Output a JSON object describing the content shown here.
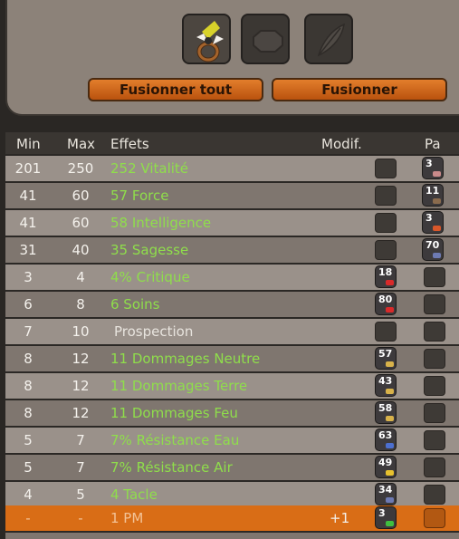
{
  "buttons": {
    "merge_all": "Fusionner tout",
    "merge": "Fusionner"
  },
  "header": {
    "min": "Min",
    "max": "Max",
    "effects": "Effets",
    "modif": "Modif.",
    "pa": "Pa"
  },
  "rows": [
    {
      "min": "201",
      "max": "250",
      "effect": "252 Vitalité",
      "pa_rune": "3",
      "pa_color": "#c98a8a"
    },
    {
      "min": "41",
      "max": "60",
      "effect": "57 Force",
      "pa_rune": "11",
      "pa_color": "#8a6b4d"
    },
    {
      "min": "41",
      "max": "60",
      "effect": "58 Intelligence",
      "pa_rune": "3",
      "pa_color": "#d9572a"
    },
    {
      "min": "31",
      "max": "40",
      "effect": "35 Sagesse",
      "pa_rune": "70",
      "pa_color": "#6d7ab3"
    },
    {
      "min": "3",
      "max": "4",
      "effect": "4% Critique",
      "mod_rune": "18",
      "mod_color": "#d92a2a"
    },
    {
      "min": "6",
      "max": "8",
      "effect": "6 Soins",
      "mod_rune": "80",
      "mod_color": "#d92a2a"
    },
    {
      "min": "7",
      "max": "10",
      "effect": "Prospection"
    },
    {
      "min": "8",
      "max": "12",
      "effect": "11 Dommages Neutre",
      "mod_rune": "57",
      "mod_color": "#d8b24a"
    },
    {
      "min": "8",
      "max": "12",
      "effect": "11 Dommages Terre",
      "mod_rune": "43",
      "mod_color": "#d8b24a"
    },
    {
      "min": "8",
      "max": "12",
      "effect": "11 Dommages Feu",
      "mod_rune": "58",
      "mod_color": "#d8b24a"
    },
    {
      "min": "5",
      "max": "7",
      "effect": "7% Résistance Eau",
      "mod_rune": "63",
      "mod_color": "#4c6fcf"
    },
    {
      "min": "5",
      "max": "7",
      "effect": "7% Résistance Air",
      "mod_rune": "49",
      "mod_color": "#e7c12e"
    },
    {
      "min": "4",
      "max": "5",
      "effect": "4 Tacle",
      "mod_rune": "34",
      "mod_color": "#6d7ab3"
    },
    {
      "min": "-",
      "max": "-",
      "effect": "1 PM",
      "modif": "+1",
      "mod_rune": "3",
      "mod_color": "#3fbf3f"
    }
  ]
}
